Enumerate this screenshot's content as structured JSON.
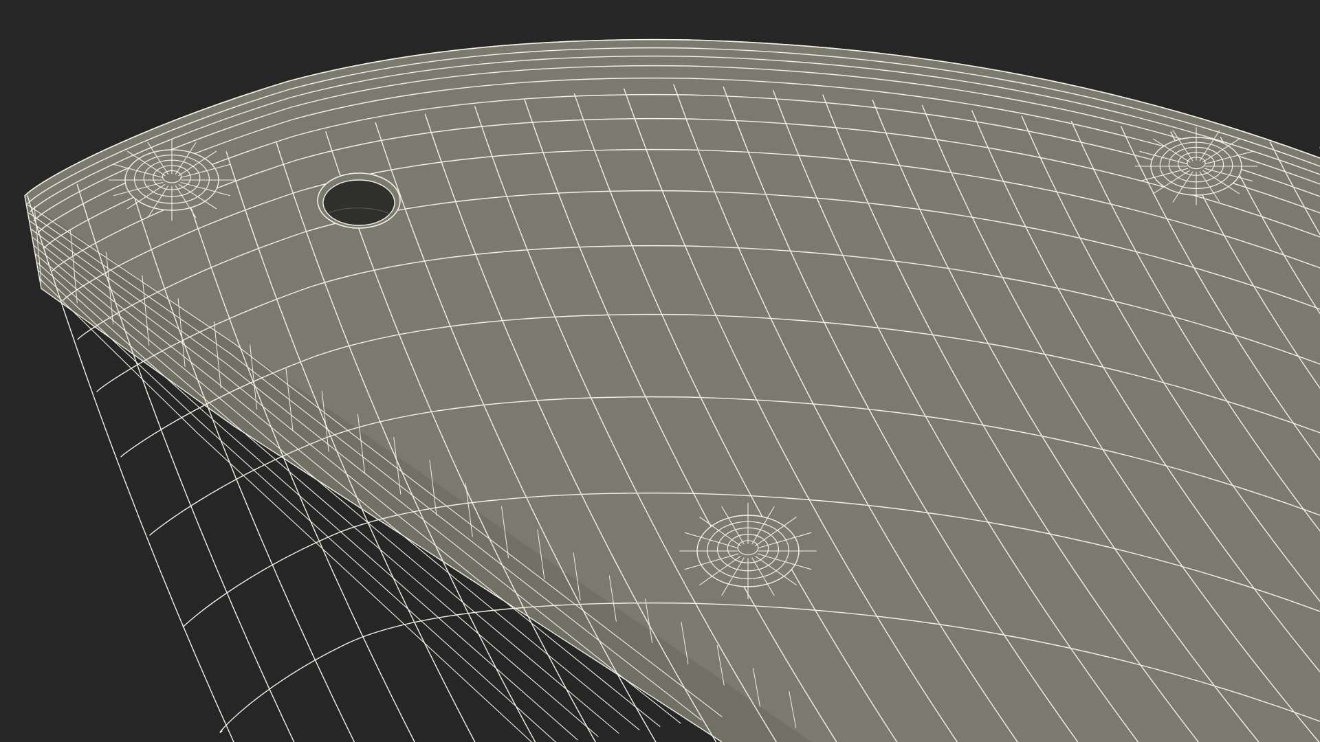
{
  "scene": {
    "background_color": "#262626",
    "surface_color": "#7a7b6e",
    "side_color": "#707164",
    "wire_color": "#f2f2e6",
    "hole_inner_color": "#2f302b",
    "objects": [
      "mesh-surface",
      "through-hole",
      "screw-head-left",
      "screw-head-right",
      "screw-head-front"
    ]
  }
}
